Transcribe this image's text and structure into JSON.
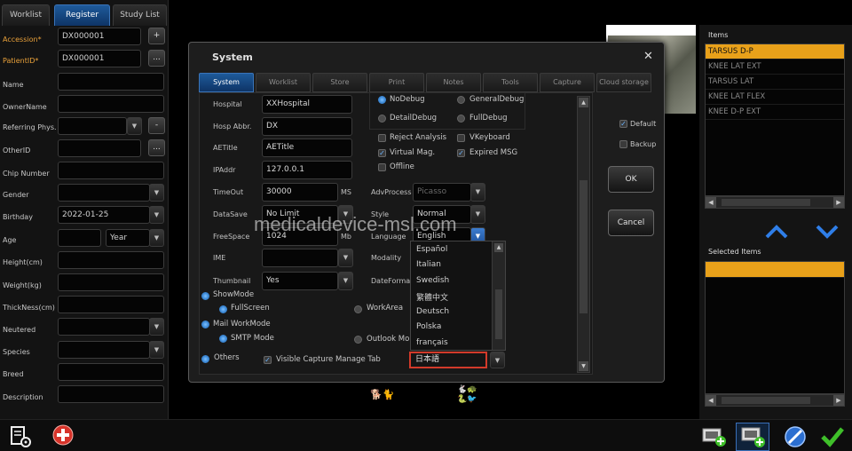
{
  "tabs": {
    "worklist": "Worklist",
    "register": "Register",
    "study_list": "Study List"
  },
  "form": {
    "accession_label": "Accession*",
    "accession_value": "DX000001",
    "patientid_label": "PatientID*",
    "patientid_value": "DX000001",
    "name_label": "Name",
    "ownername_label": "OwnerName",
    "referring_label": "Referring Phys.",
    "otherid_label": "OtherID",
    "chip_label": "Chip Number",
    "gender_label": "Gender",
    "birthday_label": "Birthday",
    "birthday_value": "2022-01-25",
    "age_label": "Age",
    "age_unit": "Year",
    "height_label": "Height(cm)",
    "weight_label": "Weight(kg)",
    "thickness_label": "ThickNess(cm)",
    "neutered_label": "Neutered",
    "species_label": "Species",
    "breed_label": "Breed",
    "description_label": "Description",
    "plus": "+",
    "dots": "...",
    "minus": "-"
  },
  "dialog": {
    "title": "System",
    "close": "✕",
    "tabs": [
      "System",
      "Worklist",
      "Store",
      "Print",
      "Notes",
      "Tools",
      "Capture",
      "Cloud storage"
    ],
    "hospital_label": "Hospital",
    "hospital_value": "XXHospital",
    "abbr_label": "Hosp Abbr.",
    "abbr_value": "DX",
    "aetitle_label": "AETitle",
    "aetitle_value": "AETitle",
    "ipaddr_label": "IPAddr",
    "ipaddr_value": "127.0.0.1",
    "timeout_label": "TimeOut",
    "timeout_value": "30000",
    "timeout_unit": "MS",
    "datasave_label": "DataSave",
    "datasave_value": "No Limit",
    "freespace_label": "FreeSpace",
    "freespace_value": "1024",
    "freespace_unit": "Mb",
    "ime_label": "IME",
    "thumbnail_label": "Thumbnail",
    "thumbnail_value": "Yes",
    "debug": {
      "nodebug": "NoDebug",
      "generaldebug": "GeneralDebug",
      "detaildebug": "DetailDebug",
      "fulldebug": "FullDebug"
    },
    "checks": {
      "reject": "Reject Analysis",
      "vkeyboard": "VKeyboard",
      "virtual": "Virtual Mag.",
      "expired": "Expired MSG",
      "offline": "Offline"
    },
    "advprocess_label": "AdvProcess",
    "advprocess_value": "Picasso",
    "style_label": "Style",
    "style_value": "Normal",
    "language_label": "Language",
    "language_value": "English",
    "modality_label": "Modality",
    "dateformat_label": "DateFormat",
    "showmode_label": "ShowMode",
    "fullscreen_label": "FullScreen",
    "workarea_label": "WorkArea",
    "mailmode_label": "Mail WorkMode",
    "smtp_label": "SMTP Mode",
    "outlook_label": "Outlook Mo",
    "others_label": "Others",
    "visible_capture_label": "Visible Capture Manage Tab",
    "default_label": "Default",
    "backup_label": "Backup",
    "ok": "OK",
    "cancel": "Cancel",
    "languages": [
      "Español",
      "Italian",
      "Swedish",
      "繁體中文",
      "Deutsch",
      "Polska",
      "français"
    ],
    "selected_language": "日本語"
  },
  "right_panel": {
    "items_label": "Items",
    "items": [
      "TARSUS D-P",
      "KNEE LAT EXT",
      "TARSUS LAT",
      "KNEE LAT FLEX",
      "KNEE D-P EXT"
    ],
    "selected_label": "Selected Items"
  },
  "watermark": "medicaldevice-msl.com",
  "colors": {
    "accent_orange": "#e9a11a",
    "tab_blue": "#1e5a9a",
    "ok_green": "#3fbf2a"
  }
}
